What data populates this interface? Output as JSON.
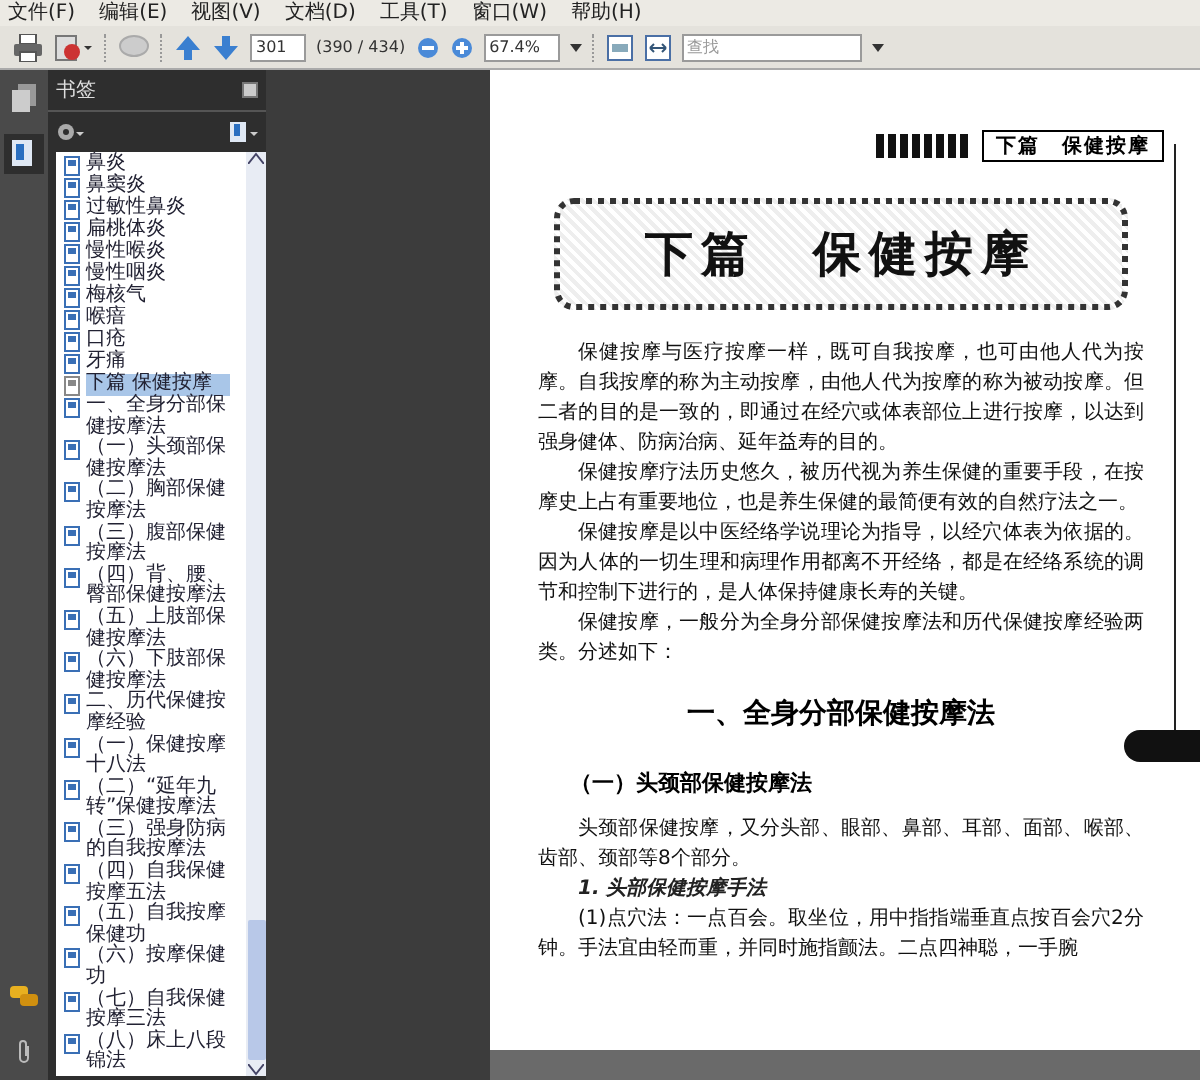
{
  "menu": [
    "文件(F)",
    "编辑(E)",
    "视图(V)",
    "文档(D)",
    "工具(T)",
    "窗口(W)",
    "帮助(H)"
  ],
  "toolbar": {
    "page_number": "301",
    "page_count": "(390 / 434)",
    "zoom": "67.4%",
    "search": {
      "placeholder": "查找"
    }
  },
  "bookmarks": {
    "title": "书签",
    "items": [
      {
        "label": "鼻炎",
        "selected": false
      },
      {
        "label": "鼻窦炎",
        "selected": false
      },
      {
        "label": "过敏性鼻炎",
        "selected": false
      },
      {
        "label": "扁桃体炎",
        "selected": false
      },
      {
        "label": "慢性喉炎",
        "selected": false
      },
      {
        "label": "慢性咽炎",
        "selected": false
      },
      {
        "label": "梅核气",
        "selected": false
      },
      {
        "label": "喉瘖",
        "selected": false
      },
      {
        "label": "口疮",
        "selected": false
      },
      {
        "label": "牙痛",
        "selected": false
      },
      {
        "label": "下篇 保健按摩",
        "selected": true
      },
      {
        "label": "一、全身分部保健按摩法",
        "selected": false
      },
      {
        "label": "（一）头颈部保健按摩法",
        "selected": false
      },
      {
        "label": "（二）胸部保健按摩法",
        "selected": false
      },
      {
        "label": "（三）腹部保健按摩法",
        "selected": false
      },
      {
        "label": "（四）背、腰、臀部保健按摩法",
        "selected": false
      },
      {
        "label": "（五）上肢部保健按摩法",
        "selected": false
      },
      {
        "label": "（六）下肢部保健按摩法",
        "selected": false
      },
      {
        "label": "二、历代保健按摩经验",
        "selected": false
      },
      {
        "label": "（一）保健按摩十八法",
        "selected": false
      },
      {
        "label": "（二）“延年九转”保健按摩法",
        "selected": false
      },
      {
        "label": "（三）强身防病的自我按摩法",
        "selected": false
      },
      {
        "label": "（四）自我保健按摩五法",
        "selected": false
      },
      {
        "label": "（五）自我按摩保健功",
        "selected": false
      },
      {
        "label": "（六）按摩保健功",
        "selected": false
      },
      {
        "label": "（七）自我保健按摩三法",
        "selected": false
      },
      {
        "label": "（八）床上八段锦法",
        "selected": false
      }
    ]
  },
  "page": {
    "running_header": "下篇　保健按摩",
    "title": "下篇　保健按摩",
    "blocks": [
      {
        "kind": "paragraph",
        "text": "保健按摩与医疗按摩一样，既可自我按摩，也可由他人代为按摩。自我按摩的称为主动按摩，由他人代为按摩的称为被动按摩。但二者的目的是一致的，即通过在经穴或体表部位上进行按摩，以达到强身健体、防病治病、延年益寿的目的。"
      },
      {
        "kind": "paragraph",
        "text": "保健按摩疗法历史悠久，被历代视为养生保健的重要手段，在按摩史上占有重要地位，也是养生保健的最简便有效的自然疗法之一。"
      },
      {
        "kind": "paragraph",
        "text": "保健按摩是以中医经络学说理论为指导，以经穴体表为依据的。因为人体的一切生理和病理作用都离不开经络，都是在经络系统的调节和控制下进行的，是人体保持健康长寿的关键。"
      },
      {
        "kind": "paragraph",
        "text": "保健按摩，一般分为全身分部保健按摩法和历代保健按摩经验两类。分述如下："
      },
      {
        "kind": "heading",
        "text": "一、全身分部保健按摩法"
      },
      {
        "kind": "subheading",
        "text": "（一）头颈部保健按摩法"
      },
      {
        "kind": "paragraph",
        "text": "头颈部保健按摩，又分头部、眼部、鼻部、耳部、面部、喉部、齿部、颈部等8个部分。"
      },
      {
        "kind": "item",
        "text": "1. 头部保健按摩手法"
      },
      {
        "kind": "paragraph",
        "text": "(1)点穴法：一点百会。取坐位，用中指指端垂直点按百会穴2分钟。手法宜由轻而重，并同时施指颤法。二点四神聪，一手腕"
      }
    ]
  }
}
